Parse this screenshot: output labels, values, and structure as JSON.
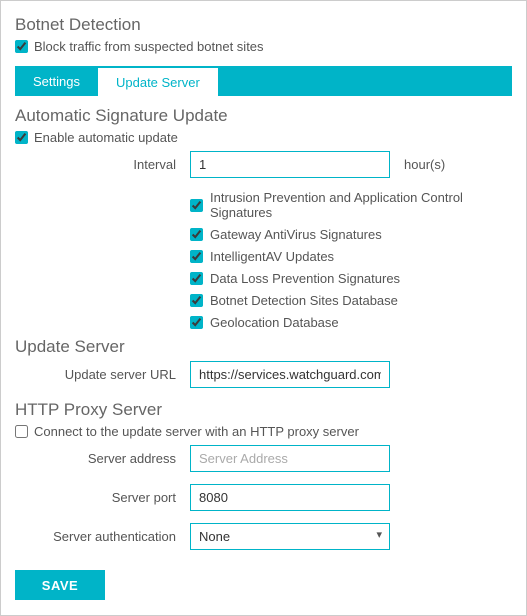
{
  "botnet": {
    "title": "Botnet Detection",
    "block_label": "Block traffic from suspected botnet sites"
  },
  "tabs": {
    "settings": "Settings",
    "update_server": "Update Server"
  },
  "auto_sig": {
    "title": "Automatic Signature Update",
    "enable_label": "Enable automatic update",
    "interval_label": "Interval",
    "interval_value": "1",
    "interval_unit": "hour(s)",
    "signatures": [
      "Intrusion Prevention and Application Control Signatures",
      "Gateway AntiVirus Signatures",
      "IntelligentAV Updates",
      "Data Loss Prevention Signatures",
      "Botnet Detection Sites Database",
      "Geolocation Database"
    ]
  },
  "update_server": {
    "title": "Update Server",
    "url_label": "Update server URL",
    "url_value": "https://services.watchguard.com"
  },
  "proxy": {
    "title": "HTTP Proxy Server",
    "connect_label": "Connect to the update server with an HTTP proxy server",
    "address_label": "Server address",
    "address_placeholder": "Server Address",
    "port_label": "Server port",
    "port_value": "8080",
    "auth_label": "Server authentication",
    "auth_value": "None"
  },
  "save_label": "SAVE"
}
